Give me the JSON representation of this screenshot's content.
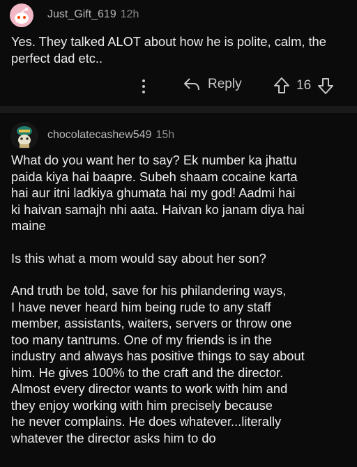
{
  "comment1": {
    "username": "Just_Gift_619",
    "time": "12h",
    "text": "Yes. They talked ALOT about how he is polite, calm, the perfect dad etc..",
    "reply_label": "Reply",
    "vote_count": "16"
  },
  "comment2": {
    "username": "chocolatecashew549",
    "time": "15h",
    "paragraphs": [
      "What do you want her to say? Ek number ka jhattu\npaida kiya hai baapre. Subeh shaam cocaine karta\nhai aur itni ladkiya ghumata hai my god! Aadmi hai\nki haivan samajh nhi aata. Haivan ko janam diya hai\nmaine",
      "Is this what a mom would say about her son?",
      "And truth be told, save for his philandering ways,\nI have never heard him being rude to any staff\nmember, assistants, waiters, servers or throw one\ntoo many tantrums. One of my friends is in the\nindustry and always has positive things to say about\nhim. He gives 100% to the craft and the director.\nAlmost every director wants to work with him and\nthey enjoy working with him precisely because\nhe never complains. He does whatever...literally\nwhatever the director asks him to do"
    ]
  },
  "colors": {
    "background": "#0b0b0b",
    "divider": "#1a1a1a",
    "avatar1": "#f2b8c6",
    "avatar2": "#1f7f6f"
  },
  "icons": {
    "avatar1": "snoo-avatar-icon",
    "avatar2": "snoo-avatar-icon",
    "more": "kebab-icon",
    "reply": "reply-arrow-icon",
    "upvote": "upvote-arrow-icon",
    "downvote": "downvote-arrow-icon"
  }
}
